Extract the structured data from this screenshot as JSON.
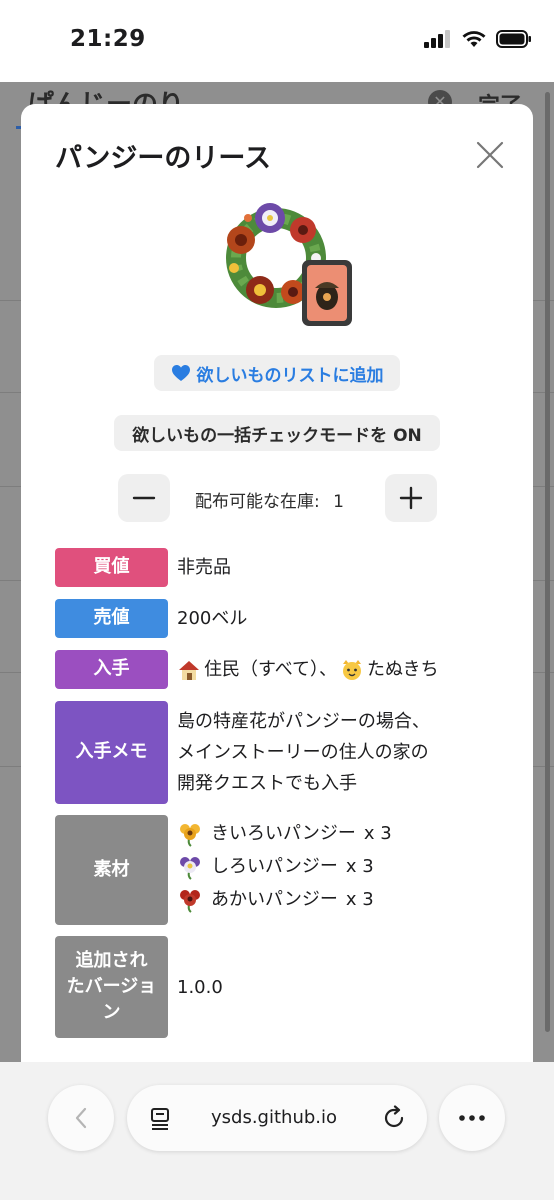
{
  "status_bar": {
    "time": "21:29"
  },
  "background_page": {
    "title": "ぱんじーのり",
    "done_label": "完了"
  },
  "modal": {
    "title": "パンジーのリース",
    "wishlist_button": "欲しいものリストに追加",
    "bulk_check_button": "欲しいもの一括チェックモードを ON",
    "stock": {
      "label": "配布可能な在庫:",
      "value": "1"
    },
    "rows": {
      "buy": {
        "label": "買値",
        "value": "非売品",
        "color": "#e0507d"
      },
      "sell": {
        "label": "売値",
        "value": "200ベル",
        "color": "#3f8ce0"
      },
      "source": {
        "label": "入手",
        "color": "#9b4fc0",
        "part1": "住民（すべて）、",
        "part2": "たぬきち"
      },
      "memo": {
        "label": "入手メモ",
        "color": "#7d54c2",
        "lines": [
          "島の特産花がパンジーの場合、",
          "メインストーリーの住人の家の",
          "開発クエストでも入手"
        ]
      },
      "materials": {
        "label": "素材",
        "color": "#8a8a8a",
        "items": [
          {
            "name": "きいろいパンジー",
            "qty": "x 3",
            "icon": "yellow-pansy-icon"
          },
          {
            "name": "しろいパンジー",
            "qty": "x 3",
            "icon": "white-pansy-icon"
          },
          {
            "name": "あかいパンジー",
            "qty": "x 3",
            "icon": "red-pansy-icon"
          }
        ]
      },
      "version": {
        "label_lines": [
          "追加され",
          "たバージョ",
          "ン"
        ],
        "value": "1.0.0",
        "color": "#8a8a8a"
      }
    }
  },
  "browser": {
    "url": "ysds.github.io"
  }
}
